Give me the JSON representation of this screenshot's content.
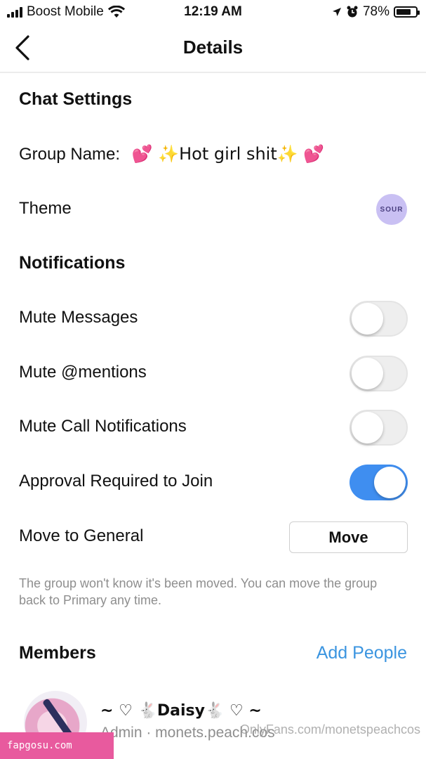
{
  "status_bar": {
    "carrier": "Boost Mobile",
    "time": "12:19 AM",
    "battery": "78%",
    "battery_level": 0.78
  },
  "nav": {
    "title": "Details"
  },
  "chat_settings": {
    "title": "Chat Settings",
    "group_name_label": "Group Name:",
    "group_name_value": "💕 ✨Hot girl shit✨ 💕",
    "theme_label": "Theme",
    "theme_icon_text": "SOUR"
  },
  "notifications": {
    "title": "Notifications",
    "mute_messages": {
      "label": "Mute Messages",
      "on": false
    },
    "mute_mentions": {
      "label": "Mute @mentions",
      "on": false
    },
    "mute_calls": {
      "label": "Mute Call Notifications",
      "on": false
    },
    "approval": {
      "label": "Approval Required to Join",
      "on": true
    },
    "move_label": "Move to General",
    "move_button": "Move",
    "helper": "The group won't know it's been moved. You can move the group back to Primary any time."
  },
  "members": {
    "title": "Members",
    "add_people": "Add People",
    "list": [
      {
        "name": "~ ♡ 🐇Daisy🐇 ♡ ~",
        "role_handle": "Admin · monets.peach.cos"
      }
    ]
  },
  "watermarks": {
    "left": "fapgosu.com",
    "right": "OnlyFans.com/monetspeachcos"
  },
  "colors": {
    "accent": "#3b95e0",
    "toggle_on": "#3f8ef0",
    "secondary_text": "#8e8e8e"
  }
}
